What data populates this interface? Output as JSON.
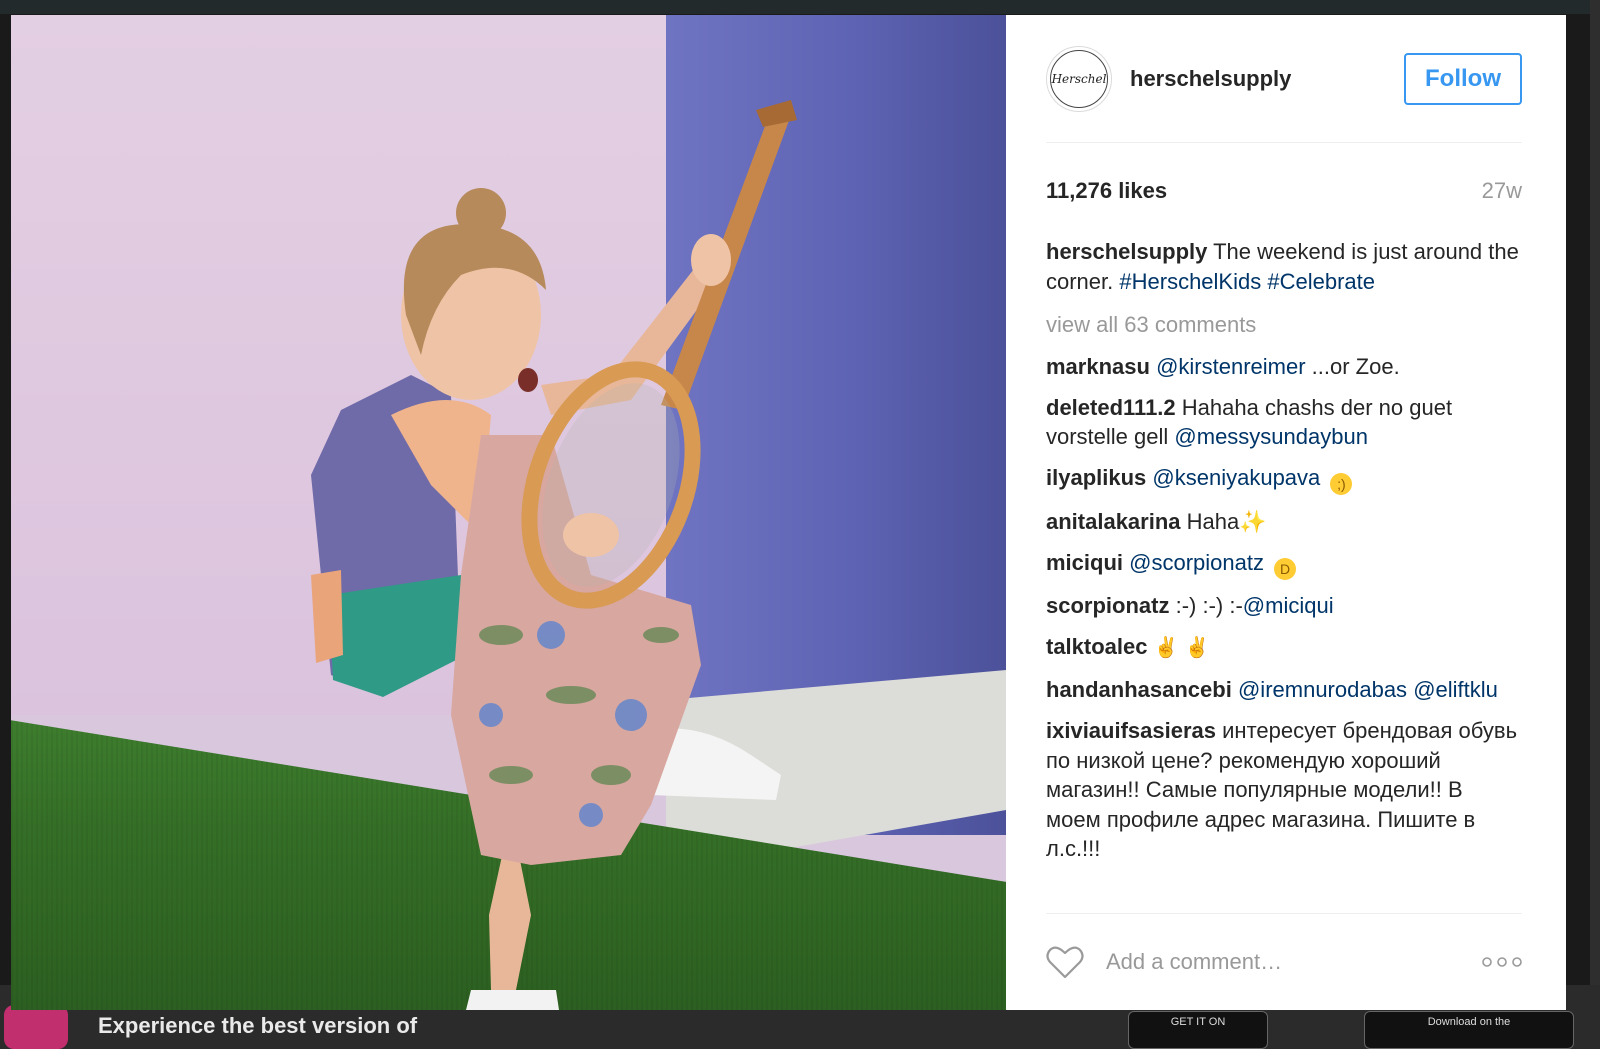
{
  "post": {
    "username": "herschelsupply",
    "follow_label": "Follow",
    "likes": "11,276 likes",
    "age": "27w",
    "avatar_text": "Herschel",
    "caption": {
      "user": "herschelsupply",
      "text": "The weekend is just around the corner.",
      "tags": [
        "#HerschelKids",
        "#Celebrate"
      ]
    },
    "view_all": "view all 63 comments",
    "comments": [
      {
        "user": "marknasu",
        "mention": "@kirstenreimer",
        "text": "...or Zoe."
      },
      {
        "user": "deleted111.2",
        "text": "Hahaha chashs der no guet vorstelle gell",
        "mention": "@messysundaybun"
      },
      {
        "user": "ilyaplikus",
        "mention": "@kseniyakupava",
        "emoji": "wink"
      },
      {
        "user": "anitalakarina",
        "text": "Haha",
        "emoji": "sparkles"
      },
      {
        "user": "miciqui",
        "mention": "@scorpionatz",
        "emoji": "tears-of-joy"
      },
      {
        "user": "scorpionatz",
        "text": ":-) :-) :-",
        "mention": "@miciqui"
      },
      {
        "user": "talktoalec",
        "emoji": "sign-of-horns x2"
      },
      {
        "user": "handanhasancebi",
        "mention": "@iremnurodabas",
        "mention2": "@eliftklu"
      },
      {
        "user": "ixiviauifsasieras",
        "text": "интересует брендовая обувь по низкой цене? рекомендую хороший магазин!! Самые популярные модели!! В моем профиле адрес магазина. Пишите в л.с.!!!"
      }
    ],
    "comment_placeholder": "Add a comment…",
    "more_symbol": "ooo"
  },
  "background": {
    "promo_text": "Experience the best version of",
    "store_left": "GET IT ON",
    "store_right": "Download on the"
  },
  "colors": {
    "accent": "#3897f0",
    "link": "#003569",
    "muted": "#999999"
  }
}
